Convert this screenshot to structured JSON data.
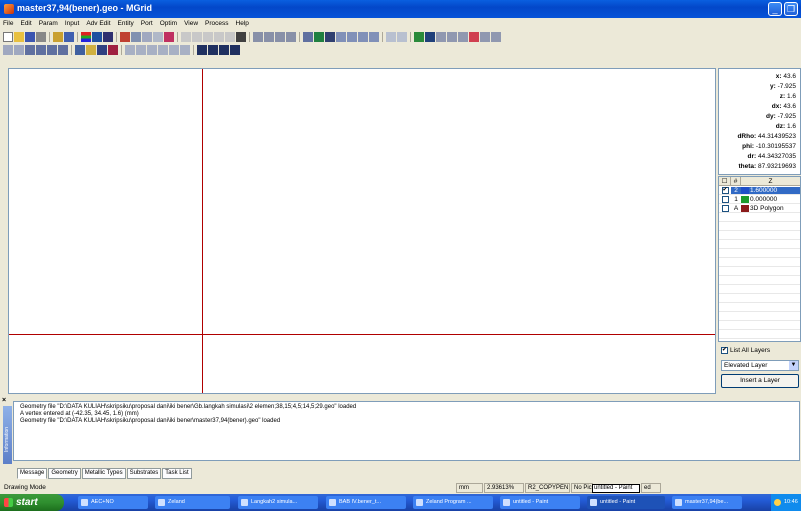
{
  "window": {
    "title": "master37,94(bener).geo - MGrid"
  },
  "menu": [
    "File",
    "Edit",
    "Param",
    "Input",
    "Adv Edit",
    "Entity",
    "Port",
    "Optim",
    "View",
    "Process",
    "Help"
  ],
  "info": {
    "x": "43.6",
    "y": "-7.925",
    "z": "1.6",
    "dx": "43.6",
    "dy": "-7.925",
    "dz": "1.6",
    "dRho": "44.31439523",
    "phi": "-10.30195537",
    "dr": "44.34327035",
    "theta": "87.93219693"
  },
  "layers": {
    "headers": [
      "#",
      "Z"
    ],
    "rows": [
      {
        "checked": true,
        "num": "2",
        "color": "#1f4fc8",
        "value": "1.600000",
        "selected": true
      },
      {
        "checked": false,
        "num": "1",
        "color": "#1c9a2c",
        "value": "0.000000",
        "selected": false
      },
      {
        "checked": false,
        "num": "A",
        "color": "#8b1a1a",
        "value": "3D Polygon",
        "selected": false
      }
    ],
    "list_all_label": "List All Layers",
    "list_all_checked": true,
    "dropdown_value": "Elevated Layer",
    "insert_label": "Insert a Layer"
  },
  "messages": [
    "Geometry file \"D:\\DATA KULIAH\\skripsiku\\proposal dani\\iki bener\\Gb.langkah simulasi\\2 elemen;38,15;4,5;14,5;29.geo\" loaded",
    "A vertex entered at (-42.35, 34.45, 1.6) (mm)",
    "Geometry file \"D:\\DATA KULIAH\\skripsiku\\proposal dani\\iki bener\\master37,94(bener).geo\" loaded"
  ],
  "message_side_label": "Information",
  "tabs": [
    "Message",
    "Geometry",
    "Metallic Types",
    "Substrates",
    "Task List"
  ],
  "status": {
    "mode": "Drawing Mode",
    "unit": "mm",
    "zoom": "2.93613%",
    "layer": "R2_COPYPEN",
    "field4": "No Pic",
    "field5": "ed"
  },
  "tooltip": "untitled - Paint",
  "taskbar": {
    "start": "start",
    "tasks": [
      "AEC+NO",
      "Zeland",
      "Langkah2 simula...",
      "BAB IV.bener_t...",
      "Zeland Program ...",
      "untitled - Paint",
      "untitled - Paint",
      "master37,94(be..."
    ],
    "clock": "10:46"
  }
}
